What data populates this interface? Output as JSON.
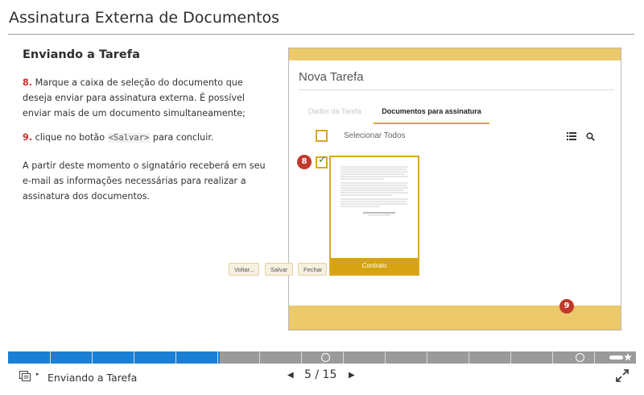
{
  "page_title": "Assinatura Externa de Documentos",
  "section_heading": "Enviando a Tarefa",
  "steps": [
    {
      "number": "8.",
      "text": "Marque a caixa de seleção do documento que deseja enviar para assinatura externa. É possível enviar mais de um documento simultaneamente;"
    },
    {
      "number": "9.",
      "text_before": "clique no botão",
      "code": "<Salvar>",
      "text_after": "para concluir."
    }
  ],
  "note": "A partir deste momento o signatário receberá em seu e-mail as informações necessárias para realizar a assinatura dos documentos.",
  "app": {
    "title": "Nova Tarefa",
    "tabs": [
      {
        "label": "Dados da Tarefa",
        "active": false
      },
      {
        "label": "Documentos para assinatura",
        "active": true
      }
    ],
    "select_all_label": "Selecionar Todos",
    "document": {
      "name": "Contrato",
      "checked": true
    },
    "buttons": {
      "back": "Voltar...",
      "save": "Salvar",
      "close": "Fechar"
    },
    "callouts": {
      "checkbox": "8",
      "save": "9"
    },
    "accent_color": "#d9a81e",
    "bar_color": "#ecc96a"
  },
  "player": {
    "current_lesson": "Enviando a Tarefa",
    "current_page": 5,
    "total_pages": 15,
    "page_separator": "/",
    "progress_fraction": 0.337,
    "segments": 15,
    "progress_color": "#1b7fd6"
  }
}
